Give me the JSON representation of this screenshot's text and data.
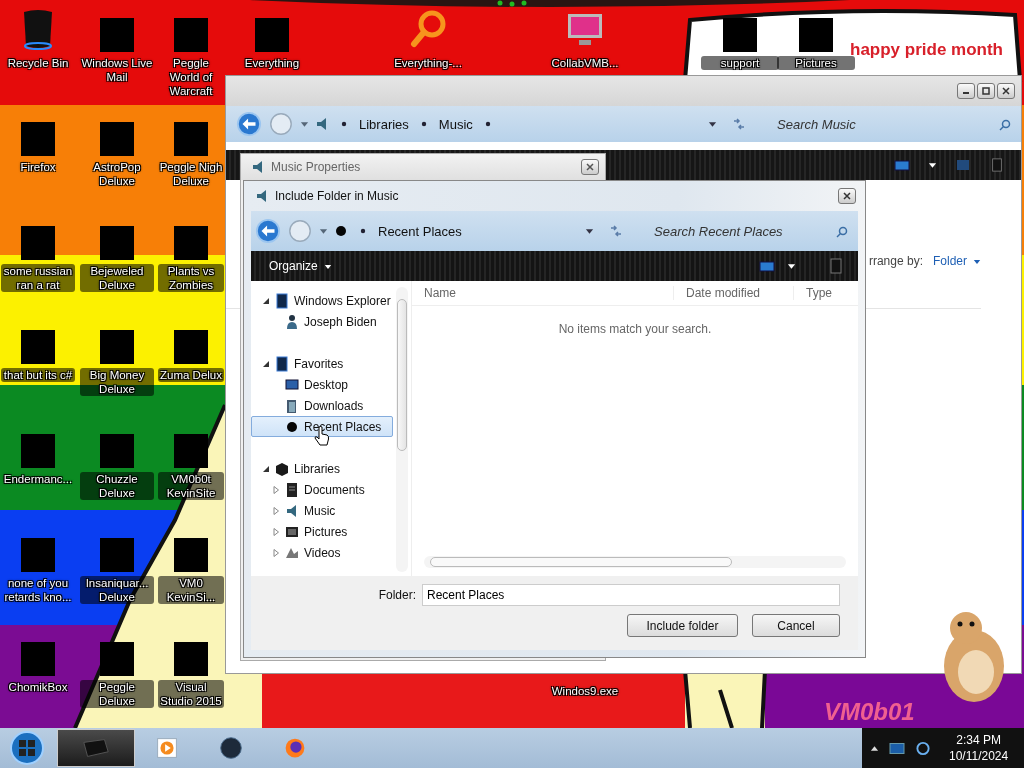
{
  "wallpaper": {
    "banner": "happy pride month",
    "signature": "VM0b01"
  },
  "desktop_icons": [
    {
      "label": "Recycle Bin",
      "kind": "bin"
    },
    {
      "label": "Windows Live Mail",
      "kind": "redacted"
    },
    {
      "label": "Peggle World of Warcraft",
      "kind": "redacted"
    },
    {
      "label": "Firefox",
      "kind": "redacted"
    },
    {
      "label": "AstroPop Deluxe",
      "kind": "redacted"
    },
    {
      "label": "Peggle Nigh Deluxe",
      "kind": "redacted"
    },
    {
      "label": "some russian ran a rat",
      "kind": "redacted"
    },
    {
      "label": "Bejeweled Deluxe",
      "kind": "redacted"
    },
    {
      "label": "Plants vs Zombies",
      "kind": "redacted"
    },
    {
      "label": "that but its c#",
      "kind": "redacted"
    },
    {
      "label": "Big Money Deluxe",
      "kind": "redacted"
    },
    {
      "label": "Zuma Delux",
      "kind": "redacted"
    },
    {
      "label": "Endermanc...",
      "kind": "redacted"
    },
    {
      "label": "Chuzzle Deluxe",
      "kind": "redacted"
    },
    {
      "label": "VM0b0t KevinSite",
      "kind": "redacted"
    },
    {
      "label": "none of you retards kno...",
      "kind": "redacted"
    },
    {
      "label": "Insaniquar... Deluxe",
      "kind": "redacted"
    },
    {
      "label": "VM0 KevinSi...",
      "kind": "redacted"
    },
    {
      "label": "ChomikBox",
      "kind": "redacted"
    },
    {
      "label": "Peggle Deluxe",
      "kind": "redacted"
    },
    {
      "label": "Visual Studio 2015",
      "kind": "redacted"
    }
  ],
  "desktop_icons_top": [
    {
      "label": "Everything",
      "kind": "redacted"
    },
    {
      "label": "Everything-...",
      "kind": "magnifier"
    },
    {
      "label": "CollabVMB...",
      "kind": "monitor"
    },
    {
      "label": "support",
      "kind": "redacted"
    },
    {
      "label": "Pictures",
      "kind": "redacted"
    }
  ],
  "desktop_icons_bottom": [
    {
      "label": "Windos9.exe"
    }
  ],
  "explorer": {
    "breadcrumb": [
      "Libraries",
      "Music"
    ],
    "search_placeholder": "Search Music",
    "arrange_label": "rrange by:",
    "arrange_value": "Folder"
  },
  "properties": {
    "title": "Music Properties"
  },
  "dialog": {
    "title": "Include Folder in Music",
    "breadcrumb": [
      "Recent Places"
    ],
    "search_placeholder": "Search Recent Places",
    "organize": "Organize",
    "tree": [
      {
        "label": "Windows Explorer",
        "expanded": true,
        "selected": false,
        "children": [
          {
            "label": "Joseph Biden",
            "selected": false
          }
        ]
      },
      {
        "label": "Favorites",
        "expanded": true,
        "selected": false,
        "children": [
          {
            "label": "Desktop",
            "selected": false
          },
          {
            "label": "Downloads",
            "selected": false
          },
          {
            "label": "Recent Places",
            "selected": true
          }
        ]
      },
      {
        "label": "Libraries",
        "expanded": true,
        "selected": false,
        "children": [
          {
            "label": "Documents",
            "expanded": false,
            "selected": false
          },
          {
            "label": "Music",
            "expanded": false,
            "selected": false
          },
          {
            "label": "Pictures",
            "expanded": false,
            "selected": false
          },
          {
            "label": "Videos",
            "expanded": false,
            "selected": false
          }
        ]
      }
    ],
    "columns": [
      "Name",
      "Date modified",
      "Type"
    ],
    "empty_message": "No items match your search.",
    "folder_label": "Folder:",
    "folder_value": "Recent Places",
    "buttons": [
      "Include folder",
      "Cancel"
    ]
  },
  "taskbar": {
    "buttons": [
      {
        "selected": true
      },
      {
        "selected": false
      },
      {
        "selected": false
      },
      {
        "selected": false
      }
    ],
    "clock": {
      "time": "2:34 PM",
      "date": "10/11/2024"
    }
  }
}
